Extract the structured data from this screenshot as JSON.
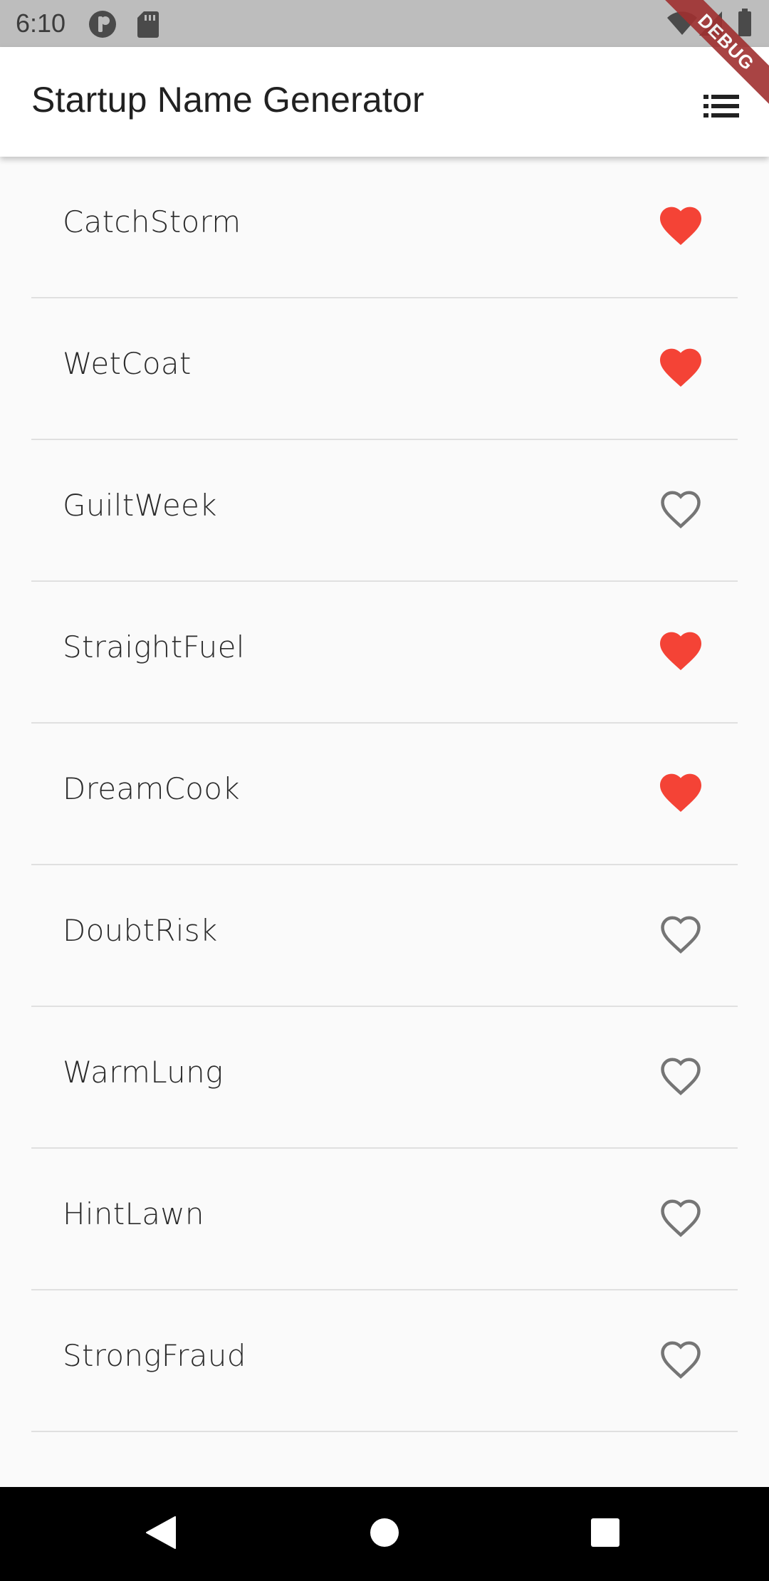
{
  "status_bar": {
    "time": "6:10",
    "icons": [
      "app-notification-icon",
      "sd-card-icon",
      "wifi-icon",
      "signal-icon",
      "battery-icon"
    ]
  },
  "debug_banner": {
    "label": "DEBUG"
  },
  "app_bar": {
    "title": "Startup Name Generator",
    "action_icon": "list-icon"
  },
  "colors": {
    "favorite": "#f44336",
    "unfavorite": "#757575",
    "divider": "#e0e0e0"
  },
  "suggestions": [
    {
      "name": "CatchStorm",
      "saved": true
    },
    {
      "name": "WetCoat",
      "saved": true
    },
    {
      "name": "GuiltWeek",
      "saved": false
    },
    {
      "name": "StraightFuel",
      "saved": true
    },
    {
      "name": "DreamCook",
      "saved": true
    },
    {
      "name": "DoubtRisk",
      "saved": false
    },
    {
      "name": "WarmLung",
      "saved": false
    },
    {
      "name": "HintLawn",
      "saved": false
    },
    {
      "name": "StrongFraud",
      "saved": false
    }
  ],
  "nav_bar": {
    "buttons": [
      "back-icon",
      "home-icon",
      "recents-icon"
    ]
  }
}
